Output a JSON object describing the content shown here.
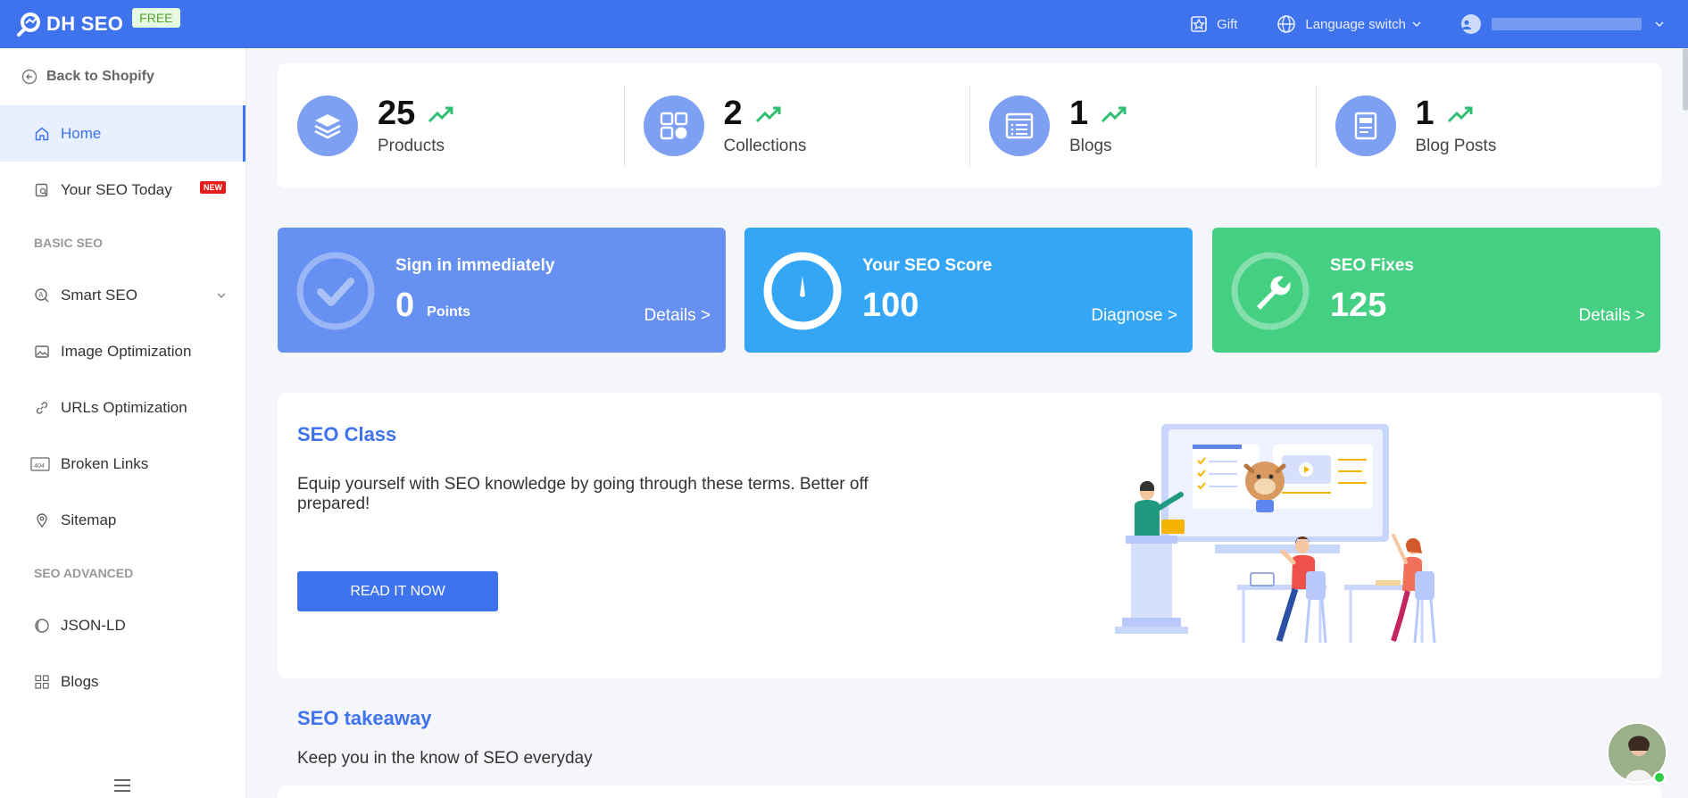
{
  "app": {
    "name": "DH SEO",
    "plan_badge": "FREE"
  },
  "topbar": {
    "gift": "Gift",
    "language": "Language switch"
  },
  "sidebar": {
    "back": "Back to Shopify",
    "items": [
      {
        "label": "Home",
        "icon": "home-icon"
      },
      {
        "label": "Your SEO Today",
        "icon": "seo-today-icon",
        "badge": "NEW"
      },
      {
        "label": "Smart SEO",
        "icon": "smart-seo-icon"
      },
      {
        "label": "Image Optimization",
        "icon": "image-icon"
      },
      {
        "label": "URLs Optimization",
        "icon": "link-icon"
      },
      {
        "label": "Broken Links",
        "icon": "broken-link-icon"
      },
      {
        "label": "Sitemap",
        "icon": "sitemap-icon"
      },
      {
        "label": "JSON-LD",
        "icon": "json-ld-icon"
      },
      {
        "label": "Blogs",
        "icon": "blogs-icon"
      }
    ],
    "sections": {
      "basic": "BASIC SEO",
      "advanced": "SEO ADVANCED"
    }
  },
  "stats": [
    {
      "value": "25",
      "label": "Products",
      "icon": "layers-icon"
    },
    {
      "value": "2",
      "label": "Collections",
      "icon": "grid-icon"
    },
    {
      "value": "1",
      "label": "Blogs",
      "icon": "list-window-icon"
    },
    {
      "value": "1",
      "label": "Blog Posts",
      "icon": "document-icon"
    }
  ],
  "cards": {
    "signin": {
      "title": "Sign in immediately",
      "value": "0",
      "unit": "Points",
      "link": "Details >"
    },
    "score": {
      "title": "Your SEO Score",
      "value": "100",
      "link": "Diagnose >"
    },
    "fixes": {
      "title": "SEO Fixes",
      "value": "125",
      "link": "Details >"
    }
  },
  "seo_class": {
    "title": "SEO Class",
    "description": "Equip yourself with SEO knowledge by going through these terms. Better off prepared!",
    "button": "READ IT NOW"
  },
  "takeaway": {
    "title": "SEO takeaway",
    "description": "Keep you in the know of SEO everyday"
  },
  "colors": {
    "primary": "#3f73ee",
    "signin": "#6690f1",
    "score": "#35a6f6",
    "fixes": "#45cf83"
  }
}
